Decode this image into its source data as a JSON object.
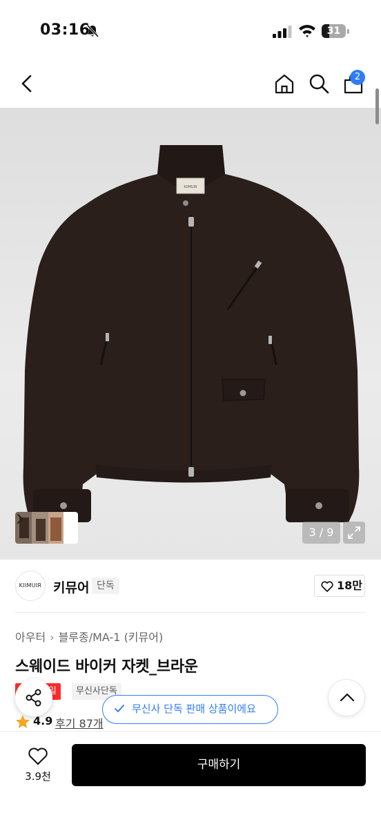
{
  "status_bar": {
    "time": "03:16",
    "battery_level": "31",
    "battery_percent": 31
  },
  "nav": {
    "cart_count": "2",
    "icons": [
      "back-icon",
      "home-icon",
      "search-icon",
      "bag-icon"
    ]
  },
  "gallery": {
    "counter": "3 / 9",
    "current_image": 3,
    "total_images": 9,
    "jacket_label": "KIIMUIR"
  },
  "brand": {
    "logo_text": "KIIMUIR",
    "name": "키뮤어",
    "tag": "단독",
    "like_count": "18만"
  },
  "breadcrumb": {
    "items": [
      "아우터",
      "블루종/MA-1 (키뮤어)"
    ]
  },
  "product": {
    "title": "스웨이드 바이커 자켓_브라운",
    "sale_badge": "세일",
    "exclusive_badge": "무신사단독",
    "rating": "4.9",
    "reviews": "후기 87개"
  },
  "toast": {
    "message": "무신사 단독 판매 상품이에요"
  },
  "bottom_bar": {
    "wishlist_count": "3.9천",
    "buy_label": "구매하기"
  },
  "colors": {
    "accent_blue": "#2f7df6",
    "sale_red": "#ff2a2a",
    "buy_button": "#000000",
    "jacket_brown": "#2a1f1b"
  }
}
